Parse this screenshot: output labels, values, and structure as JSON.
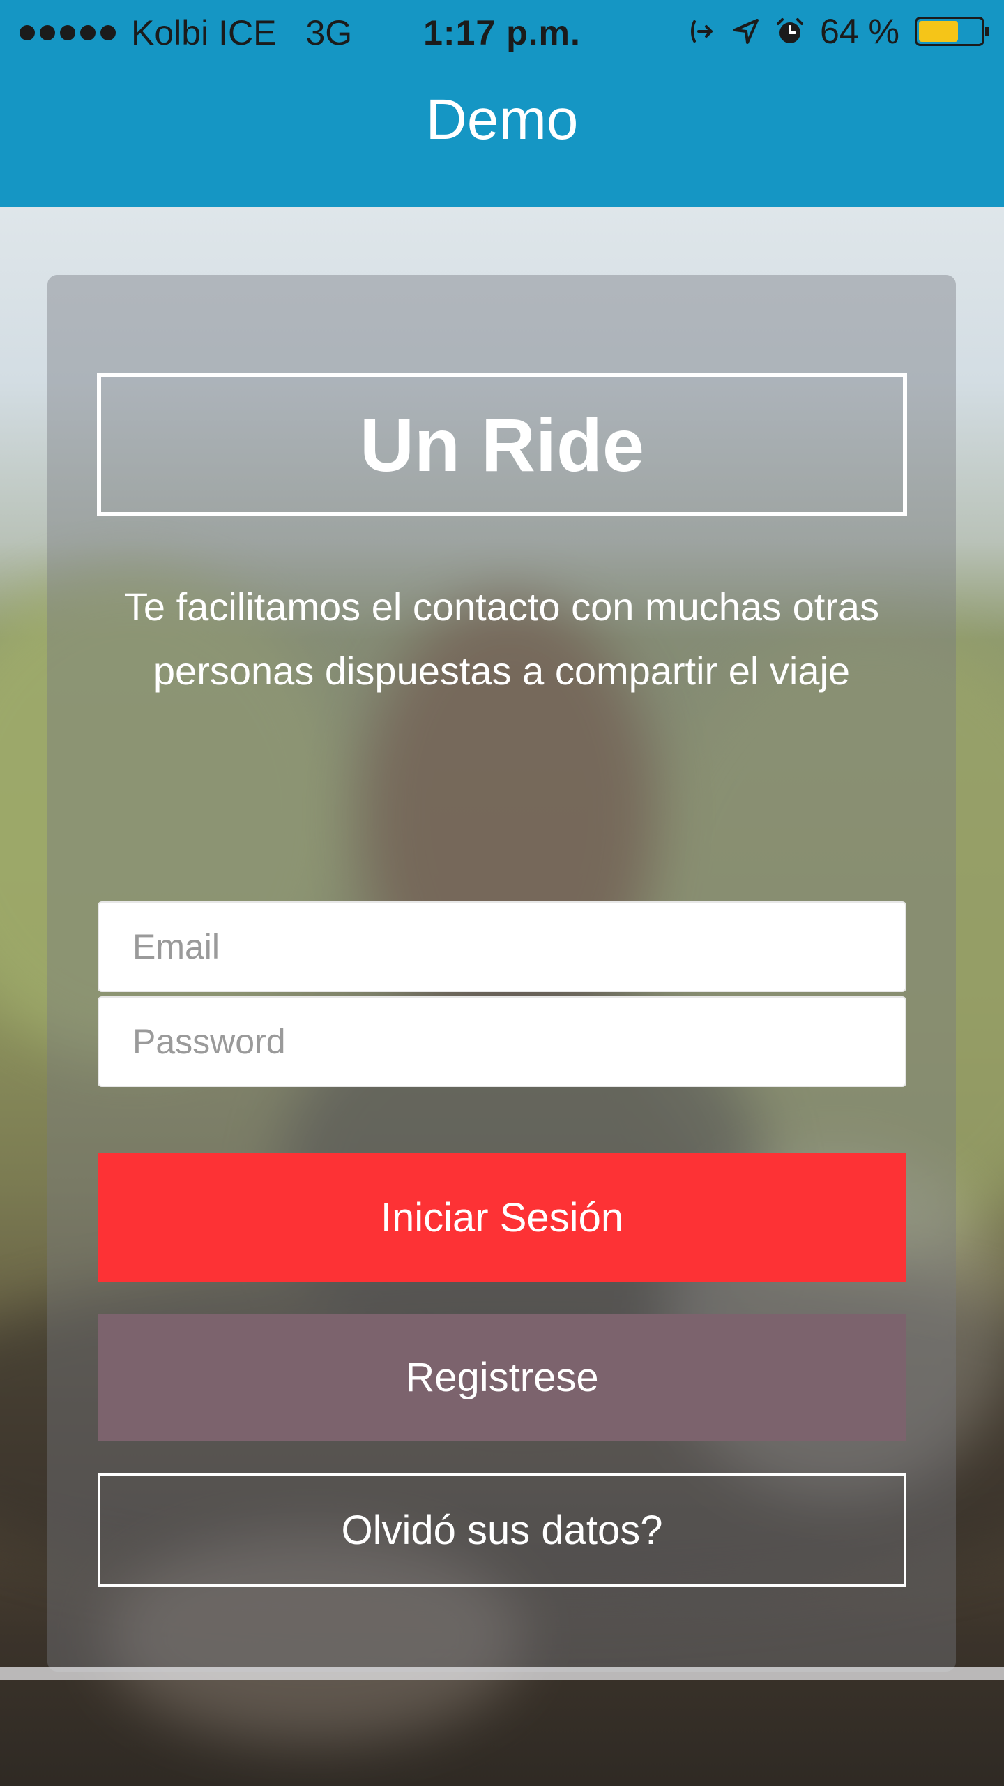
{
  "status_bar": {
    "carrier": "Kolbi ICE",
    "network": "3G",
    "time": "1:17 p.m.",
    "battery": "64 %",
    "battery_level": 0.64,
    "icons": [
      "signal-dots-icon",
      "call-forward-icon",
      "location-arrow-icon",
      "alarm-icon",
      "battery-icon"
    ]
  },
  "nav": {
    "title": "Demo"
  },
  "login": {
    "logo_text": "Un Ride",
    "tagline": "Te facilitamos el contacto con muchas otras personas dispuestas a compartir el viaje",
    "email_placeholder": "Email",
    "password_placeholder": "Password",
    "login_label": "Iniciar Sesión",
    "register_label": "Registrese",
    "forgot_label": "Olvidó sus datos?"
  },
  "colors": {
    "nav_bar": "#1596c4",
    "login_button": "#fd3235",
    "register_button": "#7c636d",
    "battery_fill": "#f5c518"
  }
}
